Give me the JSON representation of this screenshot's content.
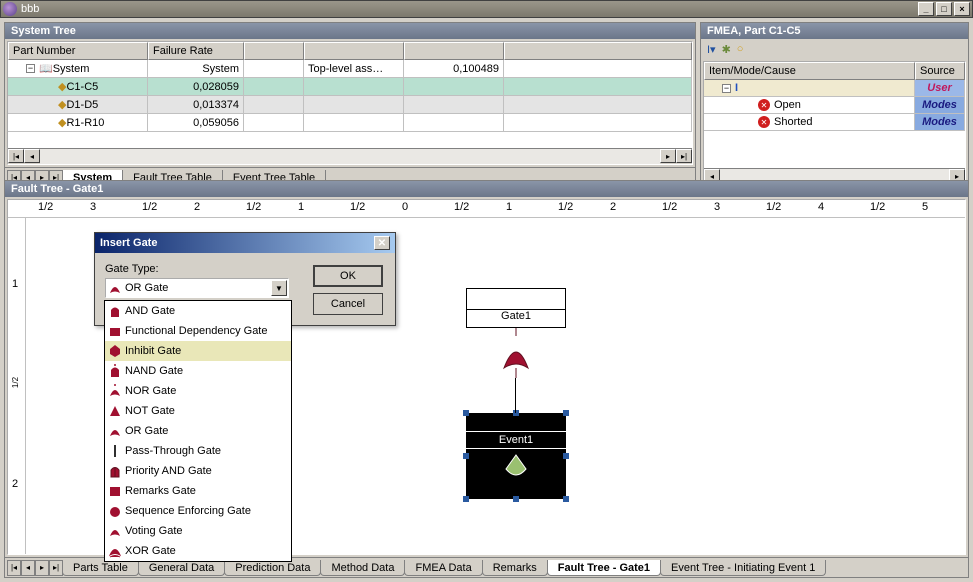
{
  "window": {
    "title": "bbb",
    "min": "_",
    "max": "□",
    "close": "×"
  },
  "systemTree": {
    "title": "System Tree",
    "headers": [
      "Part Number",
      "Failure Rate",
      "",
      "",
      "",
      ""
    ],
    "rows": [
      {
        "name": "System",
        "rate": "System",
        "c3": "",
        "c4": "Top-level ass…",
        "c5": "0,100489",
        "sel": false,
        "indent": 1
      },
      {
        "name": "C1-C5",
        "rate": "0,028059",
        "c3": "",
        "c4": "",
        "c5": "",
        "sel": true,
        "indent": 2
      },
      {
        "name": "D1-D5",
        "rate": "0,013374",
        "c3": "",
        "c4": "",
        "c5": "",
        "sel": false,
        "alt": true,
        "indent": 2
      },
      {
        "name": "R1-R10",
        "rate": "0,059056",
        "c3": "",
        "c4": "",
        "c5": "",
        "sel": false,
        "indent": 2
      }
    ],
    "tabs": [
      "System",
      "Fault Tree Table",
      "Event Tree Table"
    ],
    "activeTab": 0
  },
  "fmea": {
    "title": "FMEA, Part C1-C5",
    "headers": [
      "Item/Mode/Cause",
      "Source"
    ],
    "rows": [
      {
        "label": "",
        "src": "User",
        "srcClass": "user",
        "indent": 1,
        "empty": true
      },
      {
        "label": "Open",
        "src": "Modes",
        "srcClass": "modes",
        "indent": 2
      },
      {
        "label": "Shorted",
        "src": "Modes",
        "srcClass": "modes",
        "indent": 2
      }
    ]
  },
  "faultTree": {
    "title": "Fault Tree - Gate1",
    "rulerMarks": [
      "1/2",
      "3",
      "1/2",
      "2",
      "1/2",
      "1",
      "1/2",
      "0",
      "1/2",
      "1",
      "1/2",
      "2",
      "1/2",
      "3",
      "1/2",
      "4",
      "1/2",
      "5"
    ],
    "gate": "Gate1",
    "event": "Event1"
  },
  "dialog": {
    "title": "Insert Gate",
    "label": "Gate Type:",
    "selected": "OR Gate",
    "ok": "OK",
    "cancel": "Cancel",
    "options": [
      "AND Gate",
      "Functional Dependency Gate",
      "Inhibit Gate",
      "NAND Gate",
      "NOR Gate",
      "NOT Gate",
      "OR Gate",
      "Pass-Through Gate",
      "Priority AND Gate",
      "Remarks Gate",
      "Sequence Enforcing Gate",
      "Voting Gate",
      "XOR Gate"
    ],
    "highlighted": 2
  },
  "bottomTabs": {
    "tabs": [
      "Parts Table",
      "General Data",
      "Prediction Data",
      "Method Data",
      "FMEA Data",
      "Remarks",
      "Fault Tree - Gate1",
      "Event Tree - Initiating Event 1"
    ],
    "active": 6
  }
}
